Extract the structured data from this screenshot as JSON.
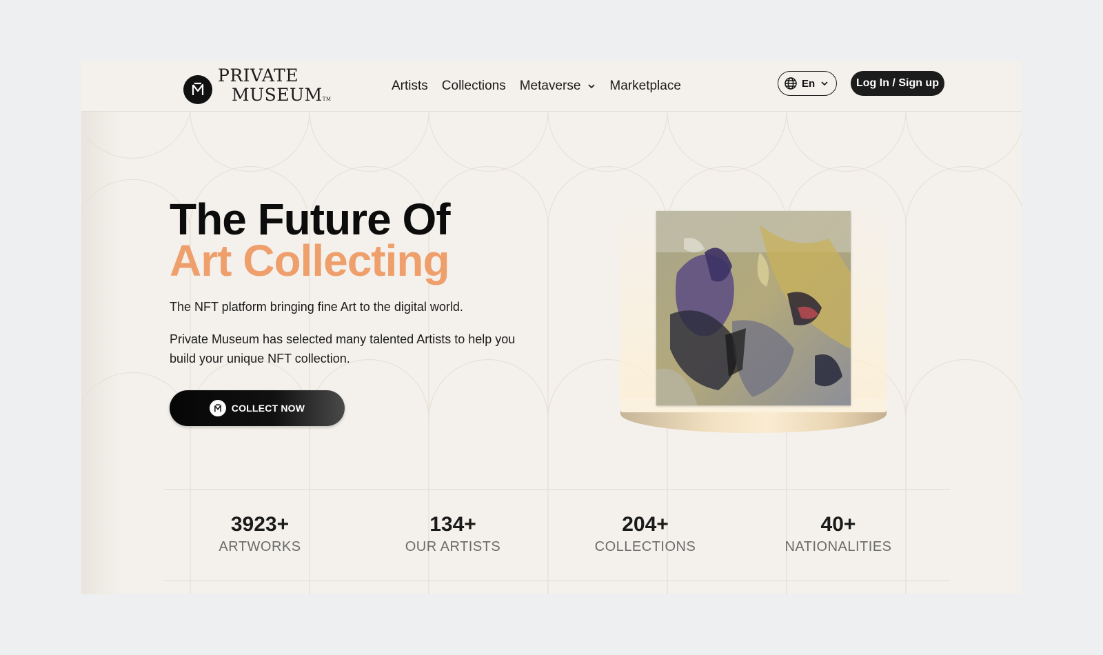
{
  "header": {
    "logo_line1": "PRIVATE",
    "logo_line2": "MUSEUM",
    "logo_tm": "TM",
    "nav": [
      {
        "label": "Artists"
      },
      {
        "label": "Collections"
      },
      {
        "label": "Metaverse"
      },
      {
        "label": "Marketplace"
      }
    ],
    "language": "En",
    "login_label": "Log In / Sign up"
  },
  "hero": {
    "title_line1": "The Future Of",
    "title_line2": "Art Collecting",
    "subtitle": "The NFT platform bringing fine Art to the digital world.",
    "description": "Private Museum has selected many talented Artists to help you build your unique NFT collection.",
    "cta_label": "COLLECT NOW"
  },
  "stats": [
    {
      "value": "3923+",
      "label": "ARTWORKS"
    },
    {
      "value": "134+",
      "label": "OUR ARTISTS"
    },
    {
      "value": "204+",
      "label": "COLLECTIONS"
    },
    {
      "value": "40+",
      "label": "NATIONALITIES"
    }
  ],
  "colors": {
    "accent": "#ee9f6c",
    "background": "#f4f1ec",
    "dark": "#111111"
  },
  "icons": {
    "logo": "museum-m-icon",
    "globe": "globe-icon",
    "chevron": "chevron-down-icon"
  }
}
